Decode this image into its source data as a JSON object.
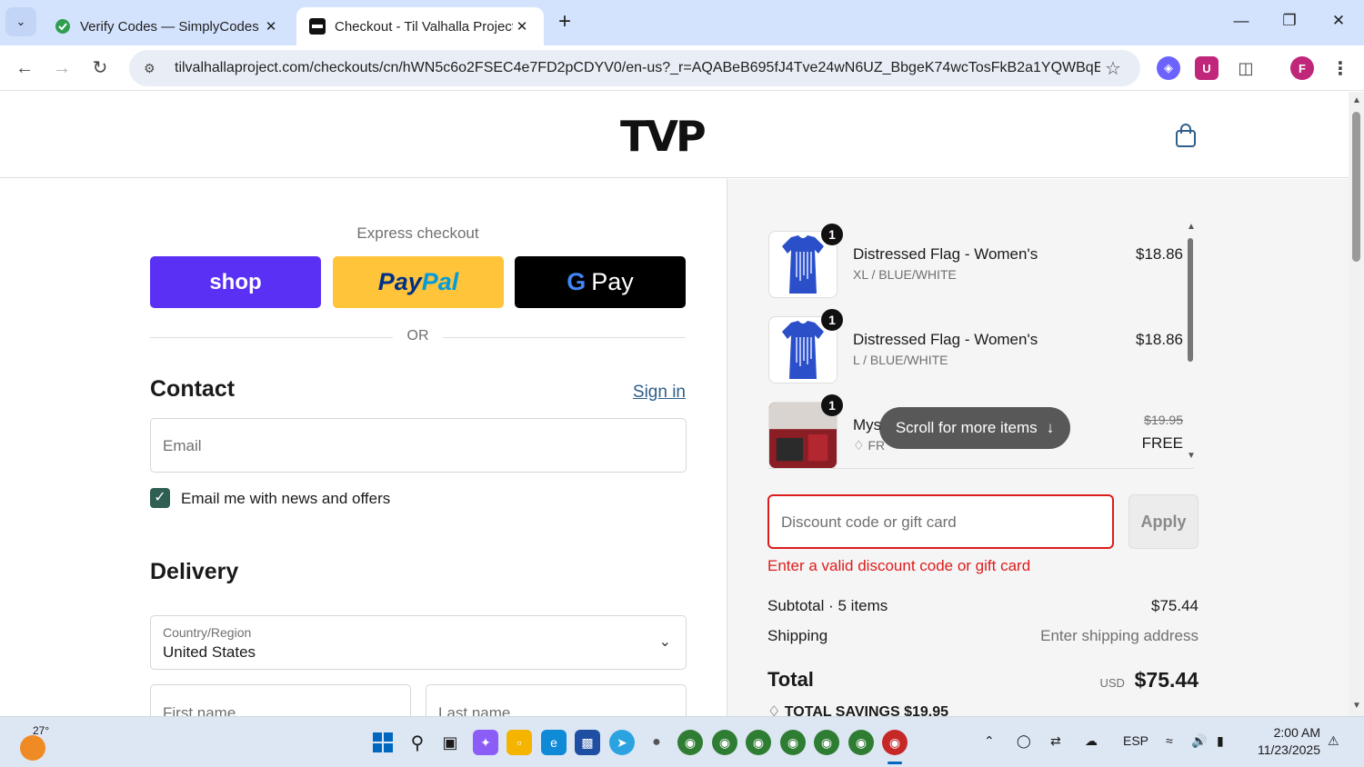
{
  "browser": {
    "tabs": [
      {
        "title": "Verify Codes — SimplyCodes",
        "active": false
      },
      {
        "title": "Checkout - Til Valhalla Project",
        "active": true
      }
    ],
    "url": "tilvalhallaproject.com/checkouts/cn/hWN5c6o2FSEC4e7FD2pCDYV0/en-us?_r=AQABeB695fJ4Tve24wN6UZ_BbgeK74wcTosFkB2a1YQWBqE...",
    "profile_initial": "F"
  },
  "header": {
    "logo_text": "TVP"
  },
  "express": {
    "label": "Express checkout",
    "shop_label": "shop",
    "paypal_pay": "Pay",
    "paypal_pal": "Pal",
    "gpay_g": "G",
    "gpay_label": "Pay",
    "or_label": "OR"
  },
  "contact": {
    "title": "Contact",
    "sign_in": "Sign in",
    "email_placeholder": "Email",
    "news_label": "Email me with news and offers",
    "news_checked": true
  },
  "delivery": {
    "title": "Delivery",
    "country_label": "Country/Region",
    "country_value": "United States",
    "first_name_placeholder": "First name",
    "last_name_placeholder": "Last name"
  },
  "summary": {
    "items": [
      {
        "qty": "1",
        "name": "Distressed Flag - Women's",
        "variant": "XL / BLUE/WHITE",
        "price": "$18.86"
      },
      {
        "qty": "1",
        "name": "Distressed Flag - Women's",
        "variant": "L / BLUE/WHITE",
        "price": "$18.86"
      },
      {
        "qty": "1",
        "name": "Mys",
        "variant": "FR",
        "old_price": "$19.95",
        "price": "FREE"
      }
    ],
    "scroll_hint": "Scroll for more items",
    "discount_placeholder": "Discount code or gift card",
    "apply_label": "Apply",
    "error": "Enter a valid discount code or gift card",
    "subtotal_label": "Subtotal · 5 items",
    "subtotal_value": "$75.44",
    "shipping_label": "Shipping",
    "shipping_value": "Enter shipping address",
    "total_label": "Total",
    "currency": "USD",
    "total_value": "$75.44",
    "savings_label": "TOTAL SAVINGS",
    "savings_value": "$19.95"
  },
  "taskbar": {
    "weather": "27°",
    "language": "ESP",
    "time": "2:00 AM",
    "date": "11/23/2025"
  },
  "colors": {
    "shop_purple": "#5a31f4",
    "paypal_yellow": "#ffc439",
    "error_red": "#dd1d1d",
    "checkbox_green": "#2f5f53",
    "link_blue": "#2f5f8a"
  }
}
